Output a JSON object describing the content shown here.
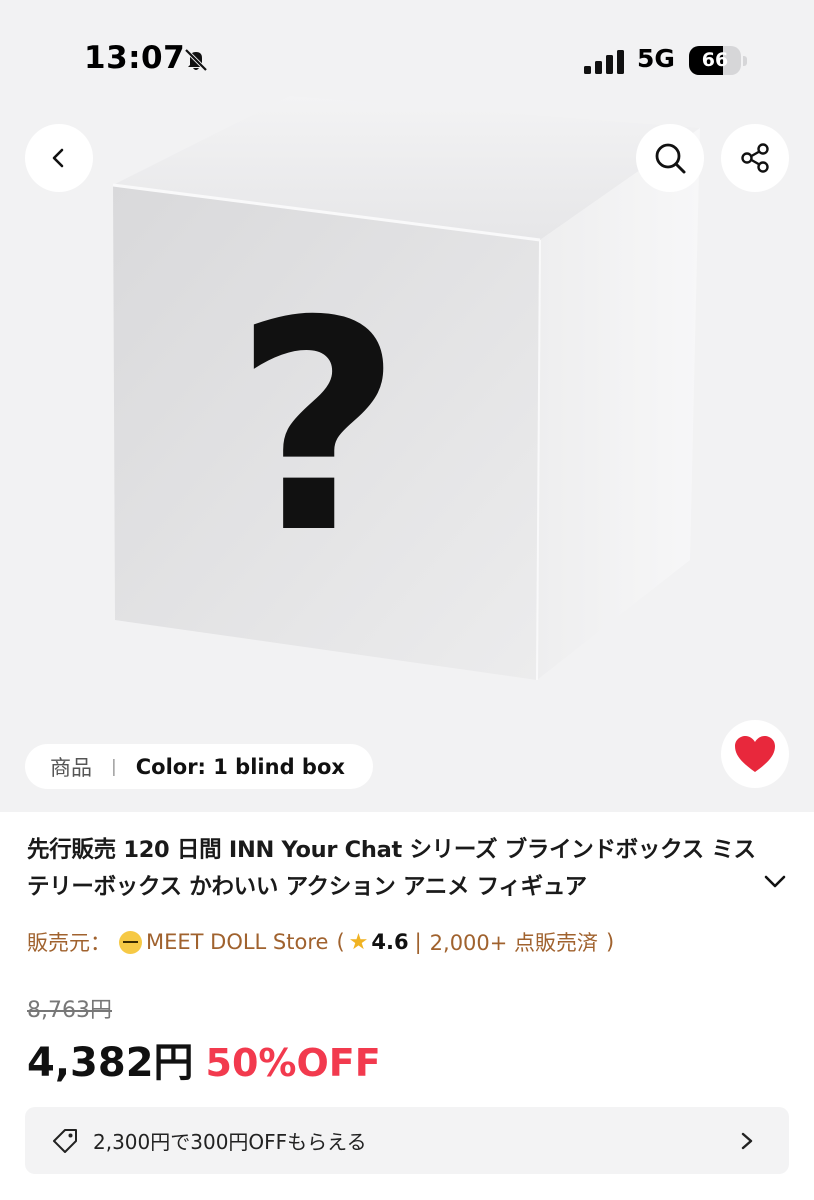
{
  "status_bar": {
    "time": "13:07",
    "network": "5G",
    "battery": "66",
    "battery_level": 0.66
  },
  "product": {
    "variant_kind": "商品",
    "variant_value": "Color: 1 blind box",
    "title": "先行販売 120 日間 INN Your Chat シリーズ ブラインドボックス ミステリーボックス かわいい アクション アニメ フィギュア",
    "box_glyph": "?"
  },
  "seller": {
    "prefix": "販売元：",
    "name": "MEET DOLL Store",
    "open_paren": "(",
    "rating": "4.6",
    "separator": "|",
    "sold": "2,000+ 点販売済",
    "close_paren": ")"
  },
  "pricing": {
    "list_price": "8,763円",
    "price": "4,382円",
    "discount": "50%OFF"
  },
  "coupon": {
    "text": "2,300円で300円OFFもらえる"
  },
  "colors": {
    "accent_red": "#f23a4e",
    "seller_brown": "#a0622e",
    "hero_bg": "#f2f2f3"
  },
  "icons": [
    "bell-slash-icon",
    "signal-icon",
    "battery-icon",
    "back-icon",
    "search-icon",
    "share-icon",
    "heart-icon",
    "chevron-down-icon",
    "tag-icon",
    "chevron-right-icon"
  ]
}
